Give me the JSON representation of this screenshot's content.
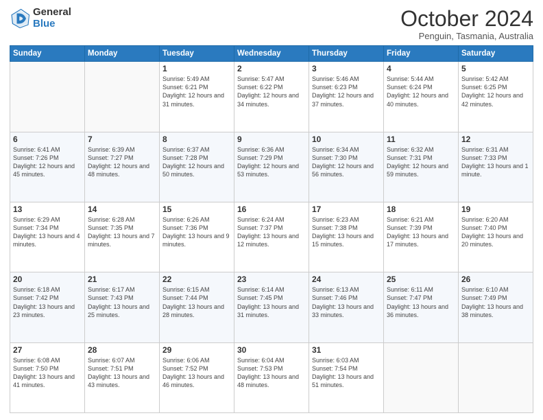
{
  "logo": {
    "general": "General",
    "blue": "Blue"
  },
  "header": {
    "month": "October 2024",
    "location": "Penguin, Tasmania, Australia"
  },
  "days_of_week": [
    "Sunday",
    "Monday",
    "Tuesday",
    "Wednesday",
    "Thursday",
    "Friday",
    "Saturday"
  ],
  "weeks": [
    [
      {
        "day": "",
        "info": ""
      },
      {
        "day": "",
        "info": ""
      },
      {
        "day": "1",
        "info": "Sunrise: 5:49 AM\nSunset: 6:21 PM\nDaylight: 12 hours and 31 minutes."
      },
      {
        "day": "2",
        "info": "Sunrise: 5:47 AM\nSunset: 6:22 PM\nDaylight: 12 hours and 34 minutes."
      },
      {
        "day": "3",
        "info": "Sunrise: 5:46 AM\nSunset: 6:23 PM\nDaylight: 12 hours and 37 minutes."
      },
      {
        "day": "4",
        "info": "Sunrise: 5:44 AM\nSunset: 6:24 PM\nDaylight: 12 hours and 40 minutes."
      },
      {
        "day": "5",
        "info": "Sunrise: 5:42 AM\nSunset: 6:25 PM\nDaylight: 12 hours and 42 minutes."
      }
    ],
    [
      {
        "day": "6",
        "info": "Sunrise: 6:41 AM\nSunset: 7:26 PM\nDaylight: 12 hours and 45 minutes."
      },
      {
        "day": "7",
        "info": "Sunrise: 6:39 AM\nSunset: 7:27 PM\nDaylight: 12 hours and 48 minutes."
      },
      {
        "day": "8",
        "info": "Sunrise: 6:37 AM\nSunset: 7:28 PM\nDaylight: 12 hours and 50 minutes."
      },
      {
        "day": "9",
        "info": "Sunrise: 6:36 AM\nSunset: 7:29 PM\nDaylight: 12 hours and 53 minutes."
      },
      {
        "day": "10",
        "info": "Sunrise: 6:34 AM\nSunset: 7:30 PM\nDaylight: 12 hours and 56 minutes."
      },
      {
        "day": "11",
        "info": "Sunrise: 6:32 AM\nSunset: 7:31 PM\nDaylight: 12 hours and 59 minutes."
      },
      {
        "day": "12",
        "info": "Sunrise: 6:31 AM\nSunset: 7:33 PM\nDaylight: 13 hours and 1 minute."
      }
    ],
    [
      {
        "day": "13",
        "info": "Sunrise: 6:29 AM\nSunset: 7:34 PM\nDaylight: 13 hours and 4 minutes."
      },
      {
        "day": "14",
        "info": "Sunrise: 6:28 AM\nSunset: 7:35 PM\nDaylight: 13 hours and 7 minutes."
      },
      {
        "day": "15",
        "info": "Sunrise: 6:26 AM\nSunset: 7:36 PM\nDaylight: 13 hours and 9 minutes."
      },
      {
        "day": "16",
        "info": "Sunrise: 6:24 AM\nSunset: 7:37 PM\nDaylight: 13 hours and 12 minutes."
      },
      {
        "day": "17",
        "info": "Sunrise: 6:23 AM\nSunset: 7:38 PM\nDaylight: 13 hours and 15 minutes."
      },
      {
        "day": "18",
        "info": "Sunrise: 6:21 AM\nSunset: 7:39 PM\nDaylight: 13 hours and 17 minutes."
      },
      {
        "day": "19",
        "info": "Sunrise: 6:20 AM\nSunset: 7:40 PM\nDaylight: 13 hours and 20 minutes."
      }
    ],
    [
      {
        "day": "20",
        "info": "Sunrise: 6:18 AM\nSunset: 7:42 PM\nDaylight: 13 hours and 23 minutes."
      },
      {
        "day": "21",
        "info": "Sunrise: 6:17 AM\nSunset: 7:43 PM\nDaylight: 13 hours and 25 minutes."
      },
      {
        "day": "22",
        "info": "Sunrise: 6:15 AM\nSunset: 7:44 PM\nDaylight: 13 hours and 28 minutes."
      },
      {
        "day": "23",
        "info": "Sunrise: 6:14 AM\nSunset: 7:45 PM\nDaylight: 13 hours and 31 minutes."
      },
      {
        "day": "24",
        "info": "Sunrise: 6:13 AM\nSunset: 7:46 PM\nDaylight: 13 hours and 33 minutes."
      },
      {
        "day": "25",
        "info": "Sunrise: 6:11 AM\nSunset: 7:47 PM\nDaylight: 13 hours and 36 minutes."
      },
      {
        "day": "26",
        "info": "Sunrise: 6:10 AM\nSunset: 7:49 PM\nDaylight: 13 hours and 38 minutes."
      }
    ],
    [
      {
        "day": "27",
        "info": "Sunrise: 6:08 AM\nSunset: 7:50 PM\nDaylight: 13 hours and 41 minutes."
      },
      {
        "day": "28",
        "info": "Sunrise: 6:07 AM\nSunset: 7:51 PM\nDaylight: 13 hours and 43 minutes."
      },
      {
        "day": "29",
        "info": "Sunrise: 6:06 AM\nSunset: 7:52 PM\nDaylight: 13 hours and 46 minutes."
      },
      {
        "day": "30",
        "info": "Sunrise: 6:04 AM\nSunset: 7:53 PM\nDaylight: 13 hours and 48 minutes."
      },
      {
        "day": "31",
        "info": "Sunrise: 6:03 AM\nSunset: 7:54 PM\nDaylight: 13 hours and 51 minutes."
      },
      {
        "day": "",
        "info": ""
      },
      {
        "day": "",
        "info": ""
      }
    ]
  ]
}
